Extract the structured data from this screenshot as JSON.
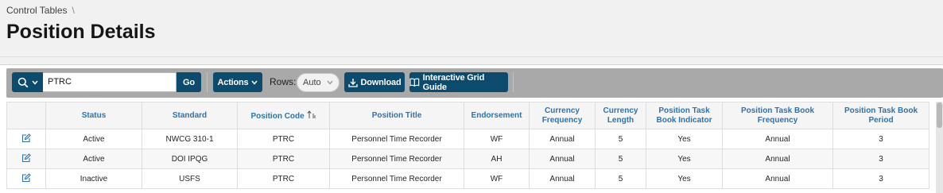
{
  "breadcrumb": {
    "parent": "Control Tables",
    "separator": "\\"
  },
  "page": {
    "title": "Position Details"
  },
  "toolbar": {
    "search_value": "PTRC",
    "go_label": "Go",
    "actions_label": "Actions",
    "rows_label": "Rows:",
    "rows_value": "Auto",
    "download_label": "Download",
    "guide_label": "Interactive Grid Guide"
  },
  "grid": {
    "columns": [
      "Status",
      "Standard",
      "Position Code",
      "Position Title",
      "Endorsement",
      "Currency Frequency",
      "Currency Length",
      "Position Task Book Indicator",
      "Position Task Book Frequency",
      "Position Task Book Period"
    ],
    "sort_column": "Position Code",
    "rows": [
      [
        "Active",
        "NWCG 310-1",
        "PTRC",
        "Personnel Time Recorder",
        "WF",
        "Annual",
        "5",
        "Yes",
        "Annual",
        "3"
      ],
      [
        "Active",
        "DOI IPQG",
        "PTRC",
        "Personnel Time Recorder",
        "AH",
        "Annual",
        "5",
        "Yes",
        "Annual",
        "3"
      ],
      [
        "Inactive",
        "USFS",
        "PTRC",
        "Personnel Time Recorder",
        "WF",
        "Annual",
        "5",
        "Yes",
        "Annual",
        "3"
      ]
    ]
  },
  "colors": {
    "accent": "#0c4a6e",
    "link": "#2a73b4",
    "toolbar": "#a9a9a9"
  },
  "icons": [
    "search-icon",
    "chevron-down-icon",
    "download-icon",
    "book-icon",
    "edit-icon",
    "sort-ascending-icon"
  ]
}
